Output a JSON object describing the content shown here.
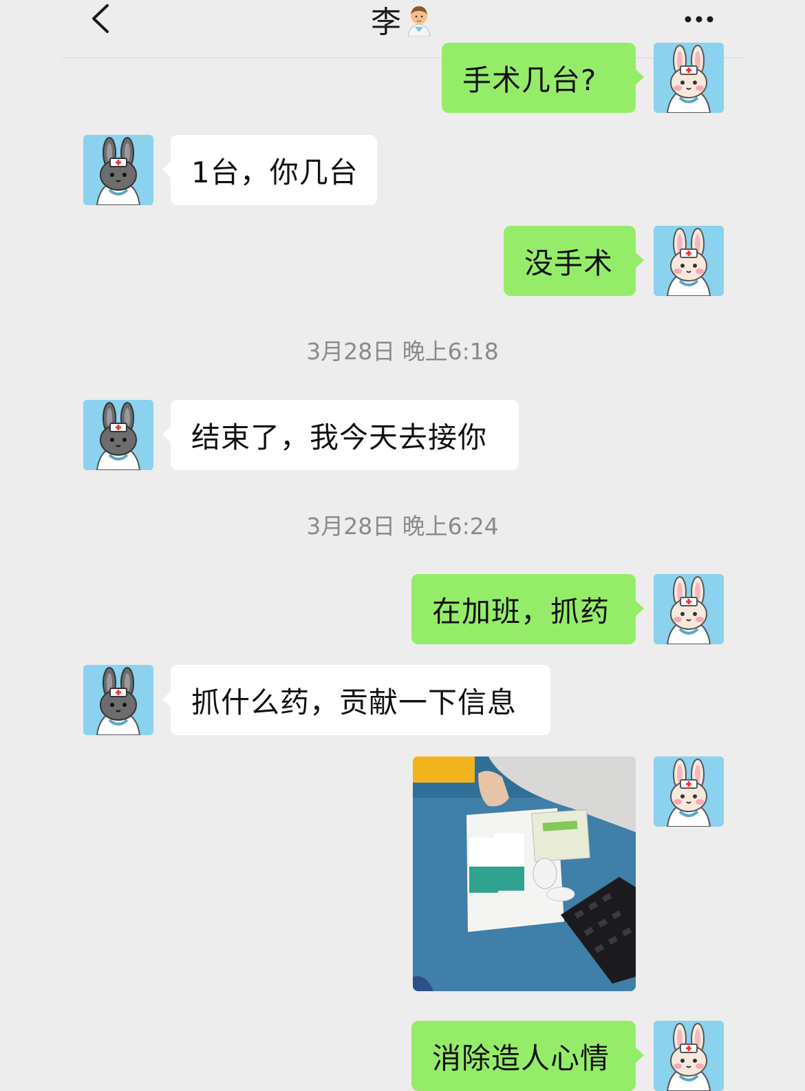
{
  "header": {
    "title": "李",
    "back_icon": "chevron-left-icon",
    "more_icon": "more-dots-icon"
  },
  "messages": [
    {
      "from": "me",
      "text": "手术几台?"
    },
    {
      "from": "other",
      "text": "1台，你几台"
    },
    {
      "from": "me",
      "text": "没手术"
    },
    {
      "type": "time",
      "text": "3月28日 晚上6:18"
    },
    {
      "from": "other",
      "text": "结束了，我今天去接你"
    },
    {
      "type": "time",
      "text": "3月28日 晚上6:24"
    },
    {
      "from": "me",
      "text": "在加班，抓药"
    },
    {
      "from": "other",
      "text": "抓什么药，贡献一下信息"
    },
    {
      "from": "me",
      "type": "image",
      "image_icon": "photo-medicine-boxes"
    },
    {
      "from": "me",
      "text": "消除造人心情"
    }
  ],
  "colors": {
    "background": "#ededed",
    "my_bubble": "#95ec69",
    "their_bubble": "#ffffff",
    "timestamp": "#8a8a8a",
    "avatar_bg": "#8ad2ee"
  }
}
